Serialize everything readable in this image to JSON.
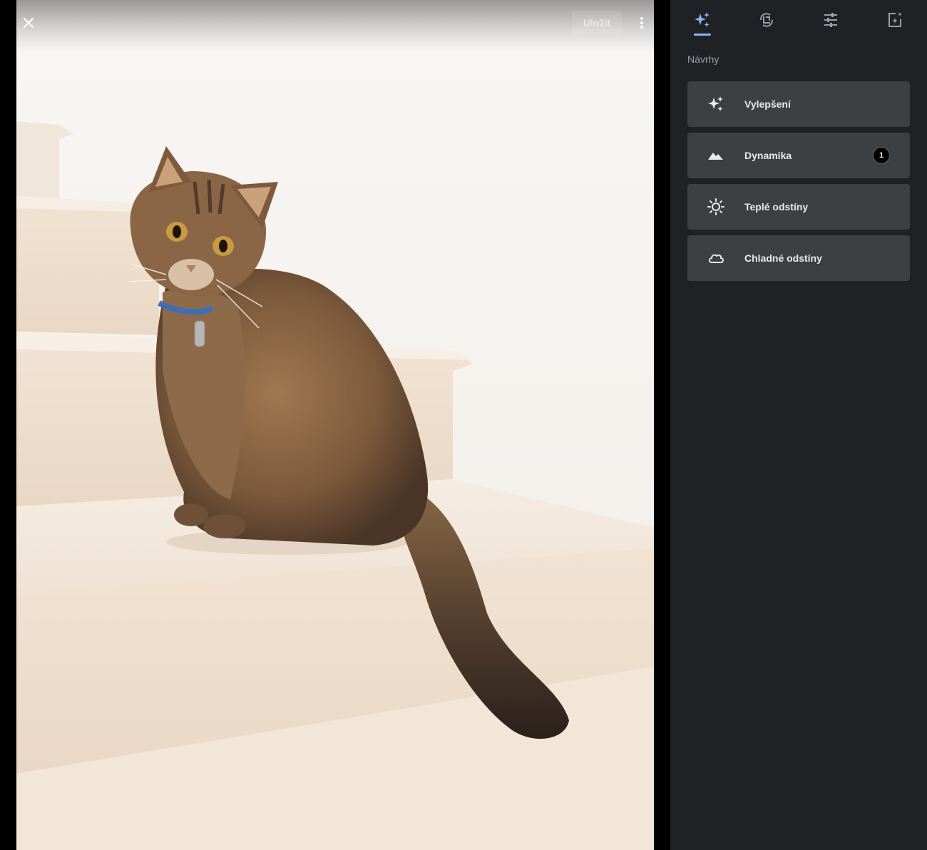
{
  "header": {
    "close_icon": "close-icon",
    "save_label": "Uložit",
    "more_icon": "more-vert-icon"
  },
  "photo": {
    "subject": "tabby cat sitting on cream stone stairs"
  },
  "tool_tabs": [
    {
      "name": "suggestions",
      "icon": "sparkle-icon",
      "active": true
    },
    {
      "name": "crop-rotate",
      "icon": "crop-rotate-icon",
      "active": false
    },
    {
      "name": "adjust",
      "icon": "sliders-icon",
      "active": false
    },
    {
      "name": "markup",
      "icon": "markup-icon",
      "active": false
    }
  ],
  "panel": {
    "section_title": "Návrhy",
    "suggestions": [
      {
        "label": "Vylepšení",
        "icon": "sparkle-icon"
      },
      {
        "label": "Dynamika",
        "icon": "mountain-icon",
        "badge": "1"
      },
      {
        "label": "Teplé odstíny",
        "icon": "sun-icon"
      },
      {
        "label": "Chladné odstíny",
        "icon": "cloud-icon"
      }
    ]
  },
  "colors": {
    "panel_bg": "#202124",
    "card_bg": "#3c4043",
    "accent": "#8ab4f8",
    "text_primary": "#e8eaed",
    "text_secondary": "#9aa0a6"
  }
}
